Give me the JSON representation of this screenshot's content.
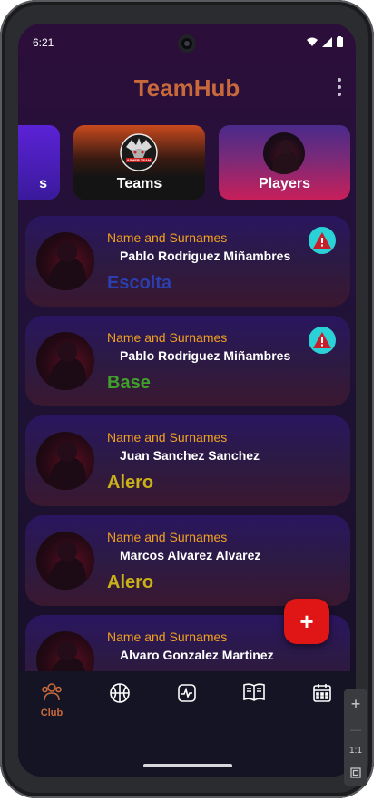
{
  "status_bar": {
    "time": "6:21"
  },
  "app": {
    "title": "TeamHub"
  },
  "categories": [
    {
      "label": "s"
    },
    {
      "label": "Teams",
      "logo_text": "ASHER TEAM"
    },
    {
      "label": "Players"
    }
  ],
  "players": [
    {
      "name_label": "Name and Surnames",
      "name": "Pablo Rodriguez Miñambres",
      "position": "Escolta",
      "position_color": "#2a3fb0",
      "alert": true
    },
    {
      "name_label": "Name and Surnames",
      "name": "Pablo Rodriguez Miñambres",
      "position": "Base",
      "position_color": "#3fa02a",
      "alert": true
    },
    {
      "name_label": "Name and Surnames",
      "name": "Juan Sanchez Sanchez",
      "position": "Alero",
      "position_color": "#c9b217",
      "alert": false
    },
    {
      "name_label": "Name and Surnames",
      "name": "Marcos Alvarez Alvarez",
      "position": "Alero",
      "position_color": "#c9b217",
      "alert": false
    },
    {
      "name_label": "Name and Surnames",
      "name": "Alvaro Gonzalez Martinez",
      "position": "",
      "position_color": "#c9b217",
      "alert": false
    }
  ],
  "fab": {
    "label": "+"
  },
  "bottom_nav": [
    {
      "label": "Club",
      "icon": "group-icon",
      "active": true
    },
    {
      "label": "",
      "icon": "basketball-icon",
      "active": false
    },
    {
      "label": "",
      "icon": "activity-icon",
      "active": false
    },
    {
      "label": "",
      "icon": "book-icon",
      "active": false
    },
    {
      "label": "",
      "icon": "calendar-icon",
      "active": false
    }
  ],
  "emulator_toolbar": {
    "zoom_in": "+",
    "zoom_out": "—",
    "ratio": "1:1"
  },
  "colors": {
    "accent": "#c8693b",
    "fab": "#e01515",
    "alert": "#2ad1d6",
    "name_label": "#f0a11f"
  }
}
